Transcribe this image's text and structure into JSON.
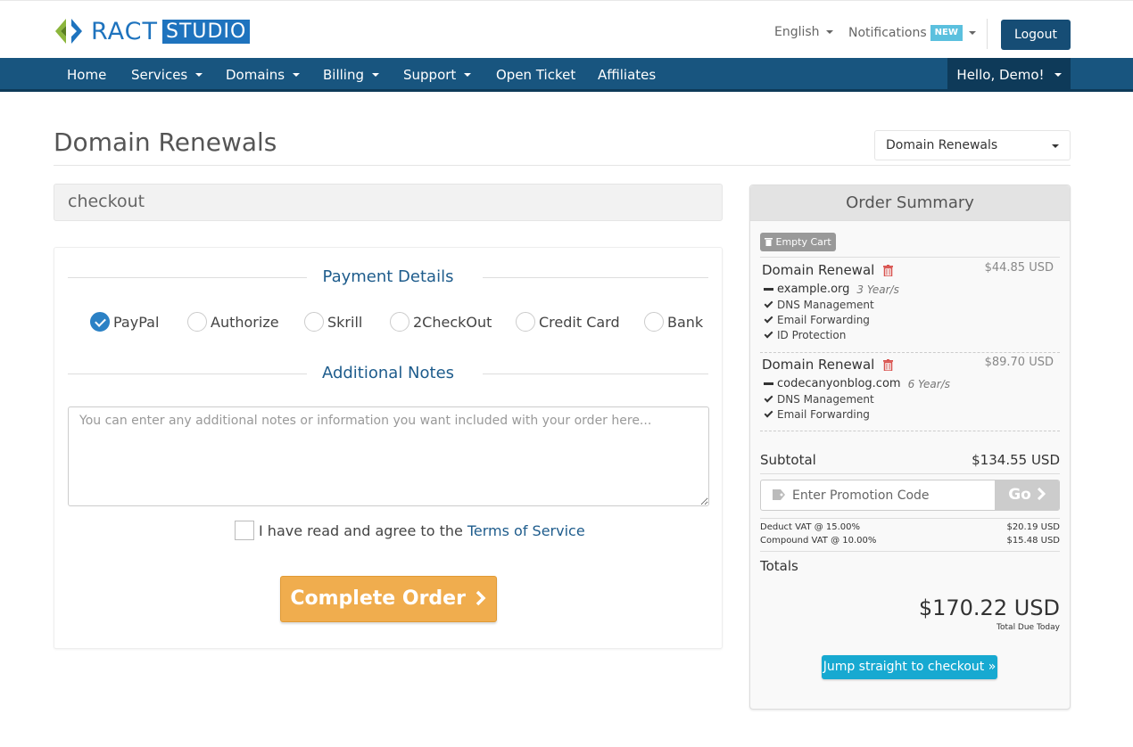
{
  "header": {
    "logo_text": "RACT",
    "logo_box": "STUDIO",
    "language": "English",
    "notifications": "Notifications",
    "new_badge": "NEW",
    "logout": "Logout"
  },
  "nav": {
    "items": [
      {
        "label": "Home",
        "dropdown": false
      },
      {
        "label": "Services",
        "dropdown": true
      },
      {
        "label": "Domains",
        "dropdown": true
      },
      {
        "label": "Billing",
        "dropdown": true
      },
      {
        "label": "Support",
        "dropdown": true
      },
      {
        "label": "Open Ticket",
        "dropdown": false
      },
      {
        "label": "Affiliates",
        "dropdown": false
      }
    ],
    "hello": "Hello, Demo!"
  },
  "page": {
    "title": "Domain Renewals",
    "category_select": "Domain Renewals",
    "checkout_label": "checkout"
  },
  "checkout": {
    "payment_heading": "Payment Details",
    "payment_methods": [
      {
        "label": "PayPal",
        "checked": true
      },
      {
        "label": "Authorize",
        "checked": false
      },
      {
        "label": "Skrill",
        "checked": false
      },
      {
        "label": "2CheckOut",
        "checked": false
      },
      {
        "label": "Credit Card",
        "checked": false
      },
      {
        "label": "Bank",
        "checked": false
      }
    ],
    "notes_heading": "Additional Notes",
    "notes_placeholder": "You can enter any additional notes or information you want included with your order here...",
    "tos_text": "I have read and agree to the",
    "tos_link": "Terms of Service",
    "complete_button": "Complete Order"
  },
  "summary": {
    "heading": "Order Summary",
    "empty_cart": "Empty Cart",
    "items": [
      {
        "name": "Domain Renewal",
        "price": "$44.85 USD",
        "domain": "example.org",
        "period": "3 Year/s",
        "addons": [
          "DNS Management",
          "Email Forwarding",
          "ID Protection"
        ]
      },
      {
        "name": "Domain Renewal",
        "price": "$89.70 USD",
        "domain": "codecanyonblog.com",
        "period": "6 Year/s",
        "addons": [
          "DNS Management",
          "Email Forwarding"
        ]
      }
    ],
    "subtotal_label": "Subtotal",
    "subtotal_value": "$134.55 USD",
    "promo_placeholder": "Enter Promotion Code",
    "promo_button": "Go",
    "taxes": [
      {
        "label": "Deduct VAT @ 15.00%",
        "value": "$20.19 USD"
      },
      {
        "label": "Compound VAT @ 10.00%",
        "value": "$15.48 USD"
      }
    ],
    "totals_label": "Totals",
    "total_value": "$170.22 USD",
    "total_caption": "Total Due Today",
    "jump_button": "Jump straight to checkout »"
  },
  "colors": {
    "brand_blue": "#1e73be",
    "nav_bg": "#18557f",
    "nav_dark": "#0e3a59",
    "accent_orange": "#f0ad4e",
    "info_cyan": "#17a9d1",
    "danger_red": "#d9534f"
  },
  "icons": {
    "logo": "ract-logo-icon",
    "trash": "trash-icon",
    "tag": "tag-icon",
    "check": "check-icon",
    "chevron": "chevron-right-icon"
  }
}
